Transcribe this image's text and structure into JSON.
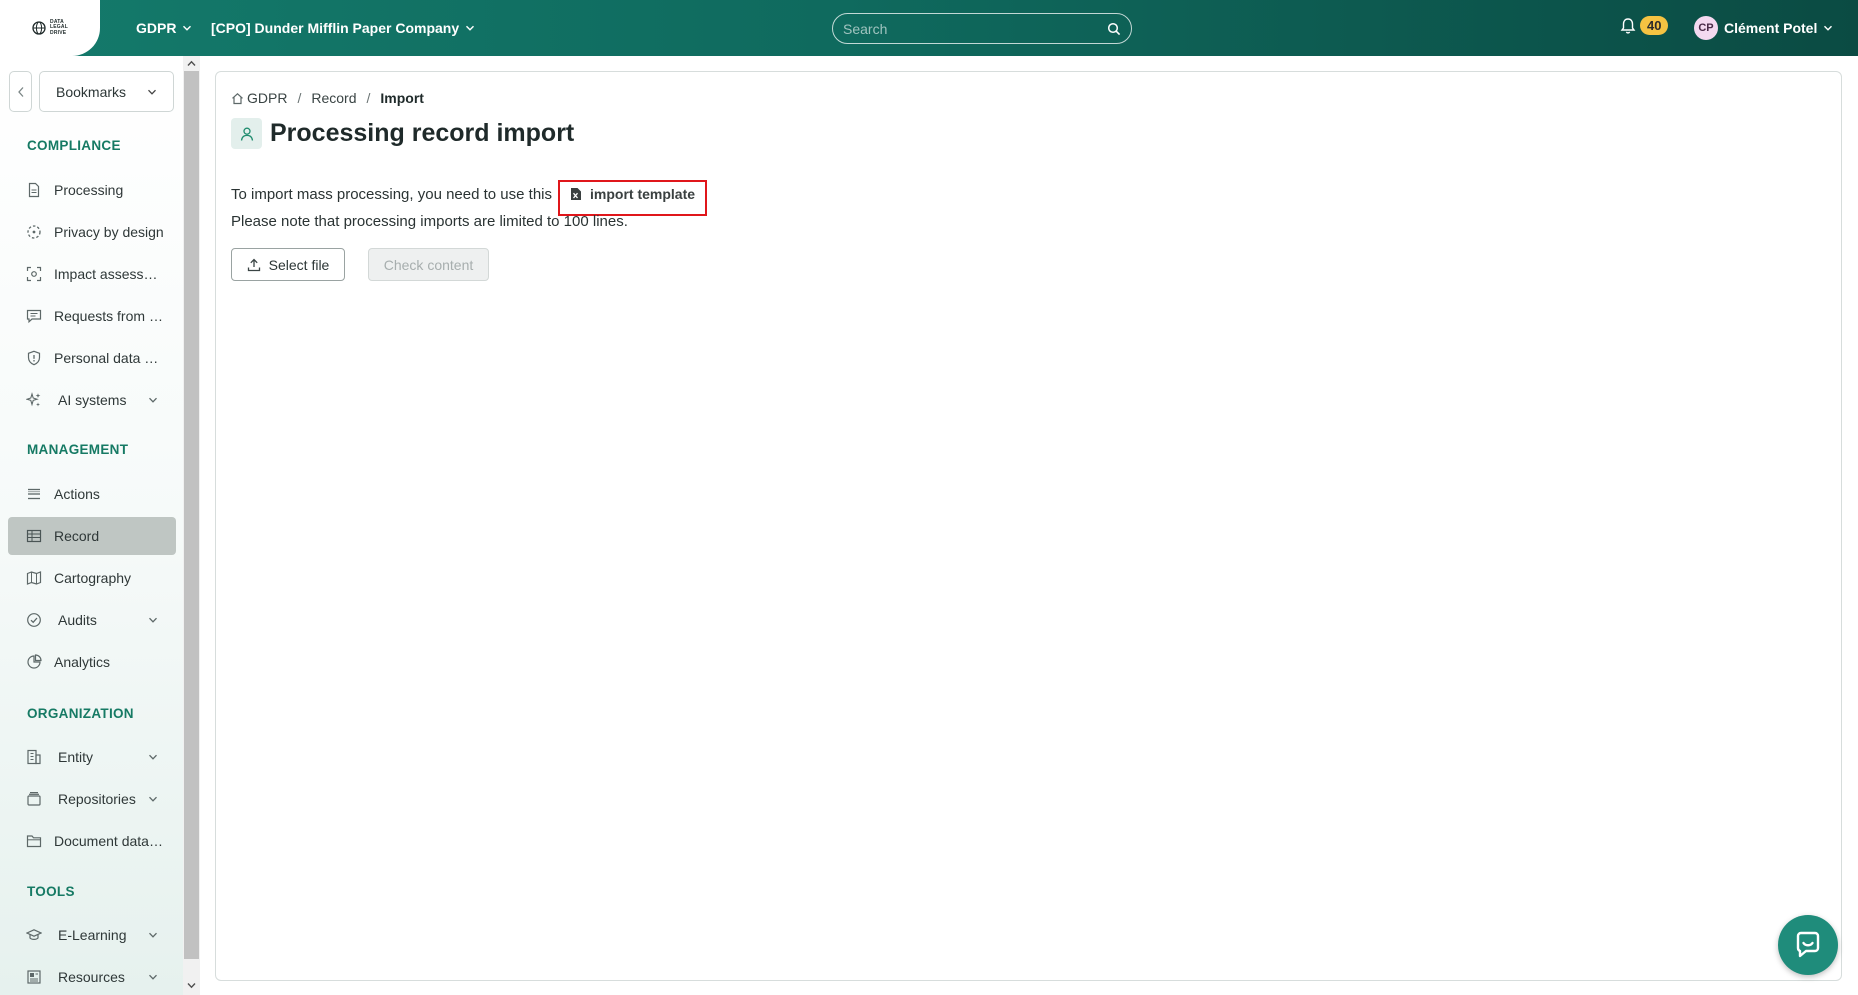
{
  "header": {
    "logo_text": [
      "DATA",
      "LEGAL",
      "DRIVE"
    ],
    "module_label": "GDPR",
    "organization_label": "[CPO] Dunder Mifflin Paper Company",
    "search_placeholder": "Search",
    "notification_count": "40",
    "user_initials": "CP",
    "user_name": "Clément Potel"
  },
  "sidebar": {
    "bookmarks_label": "Bookmarks",
    "sections": {
      "compliance": "COMPLIANCE",
      "management": "MANAGEMENT",
      "organization": "ORGANIZATION",
      "tools": "TOOLS"
    },
    "items": {
      "processing": "Processing",
      "privacy_by_design": "Privacy by design",
      "impact_assessment": "Impact assessm…",
      "requests": "Requests from d…",
      "personal_data_breach": "Personal data br…",
      "ai_systems": "AI systems",
      "actions": "Actions",
      "record": "Record",
      "cartography": "Cartography",
      "audits": "Audits",
      "analytics": "Analytics",
      "entity": "Entity",
      "repositories": "Repositories",
      "document_database": "Document datab…",
      "e_learning": "E-Learning",
      "resources": "Resources"
    },
    "active_item": "Record"
  },
  "breadcrumb": {
    "home": "GDPR",
    "level2": "Record",
    "current": "Import",
    "separator": "/"
  },
  "page": {
    "title": "Processing record import",
    "instruction": "To import mass processing, you need to use this",
    "template_link": "import template",
    "note": "Please note that processing imports are limited to 100 lines.",
    "select_file_label": "Select file",
    "check_content_label": "Check content"
  },
  "colors": {
    "brand": "#147a6b",
    "section_heading": "#167a64",
    "badge": "#f6c342",
    "highlight_box": "#e0161b",
    "active_item_bg": "#bfc6c3"
  }
}
